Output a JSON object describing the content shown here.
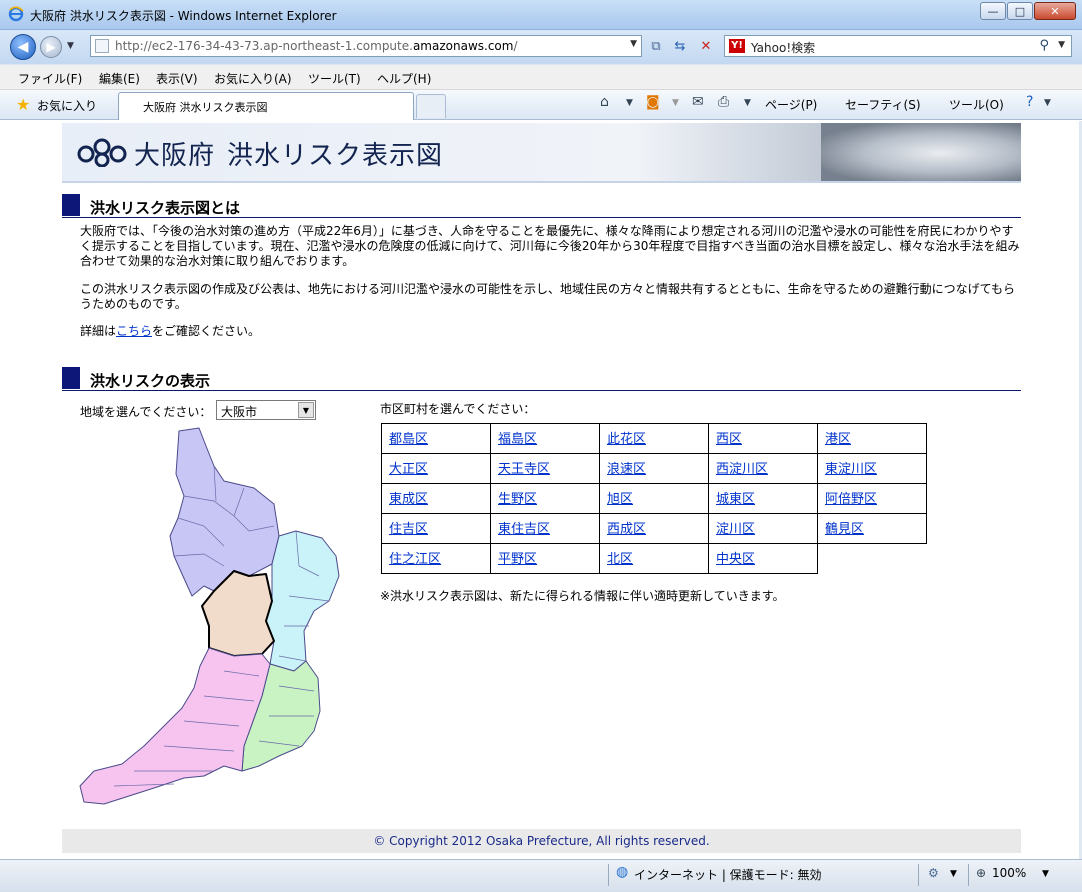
{
  "window": {
    "title": "大阪府 洪水リスク表示図 - Windows Internet Explorer",
    "minimize": "—",
    "maximize": "□",
    "close": "✕"
  },
  "nav": {
    "address_prefix": "http://ec2-176-34-43-73.ap-northeast-1.compute.",
    "address_domain": "amazonaws.com",
    "address_suffix": "/",
    "search_engine": "Y!",
    "search_placeholder": "Yahoo!検索"
  },
  "menu": {
    "items": [
      "ファイル(F)",
      "編集(E)",
      "表示(V)",
      "お気に入り(A)",
      "ツール(T)",
      "ヘルプ(H)"
    ]
  },
  "favorites": {
    "label": "お気に入り",
    "tab_title": "大阪府 洪水リスク表示図",
    "commands": [
      "ページ(P)",
      "セーフティ(S)",
      "ツール(O)"
    ]
  },
  "page": {
    "banner_title_1": "大阪府",
    "banner_title_2": "洪水リスク表示図",
    "section1_title": "洪水リスク表示図とは",
    "para1": "大阪府では、「今後の治水対策の進め方（平成22年6月）」に基づき、人命を守ることを最優先に、様々な降雨により想定される河川の氾濫や浸水の可能性を府民にわかりやすく提示することを目指しています。現在、氾濫や浸水の危険度の低減に向けて、河川毎に今後20年から30年程度で目指すべき当面の治水目標を設定し、様々な治水手法を組み合わせて効果的な治水対策に取り組んでおります。",
    "para2": "この洪水リスク表示図の作成及び公表は、地先における河川氾濫や浸水の可能性を示し、地域住民の方々と情報共有するとともに、生命を守るための避難行動につなげてもらうためのものです。",
    "detail_prefix": "詳細は",
    "detail_link": "こちら",
    "detail_suffix": "をご確認ください。",
    "section2_title": "洪水リスクの表示",
    "region_label": "地域を選んでください：",
    "region_selected": "大阪市",
    "city_label": "市区町村を選んでください：",
    "cities": [
      [
        "都島区",
        "福島区",
        "此花区",
        "西区",
        "港区"
      ],
      [
        "大正区",
        "天王寺区",
        "浪速区",
        "西淀川区",
        "東淀川区"
      ],
      [
        "東成区",
        "生野区",
        "旭区",
        "城東区",
        "阿倍野区"
      ],
      [
        "住吉区",
        "東住吉区",
        "西成区",
        "淀川区",
        "鶴見区"
      ],
      [
        "住之江区",
        "平野区",
        "北区",
        "中央区"
      ]
    ],
    "note": "※洪水リスク表示図は、新たに得られる情報に伴い適時更新していきます。",
    "copyright": "© Copyright 2012 Osaka Prefecture, All rights reserved."
  },
  "status": {
    "zone": "インターネット | 保護モード: 無効",
    "zoom": "100%"
  },
  "colors": {
    "north": "#c8c6f4",
    "osaka_city": "#f1dccb",
    "east": "#c9f3f8",
    "south_east": "#c9f3c3",
    "south": "#f6c4ef",
    "heading_square": "#0c1778"
  }
}
